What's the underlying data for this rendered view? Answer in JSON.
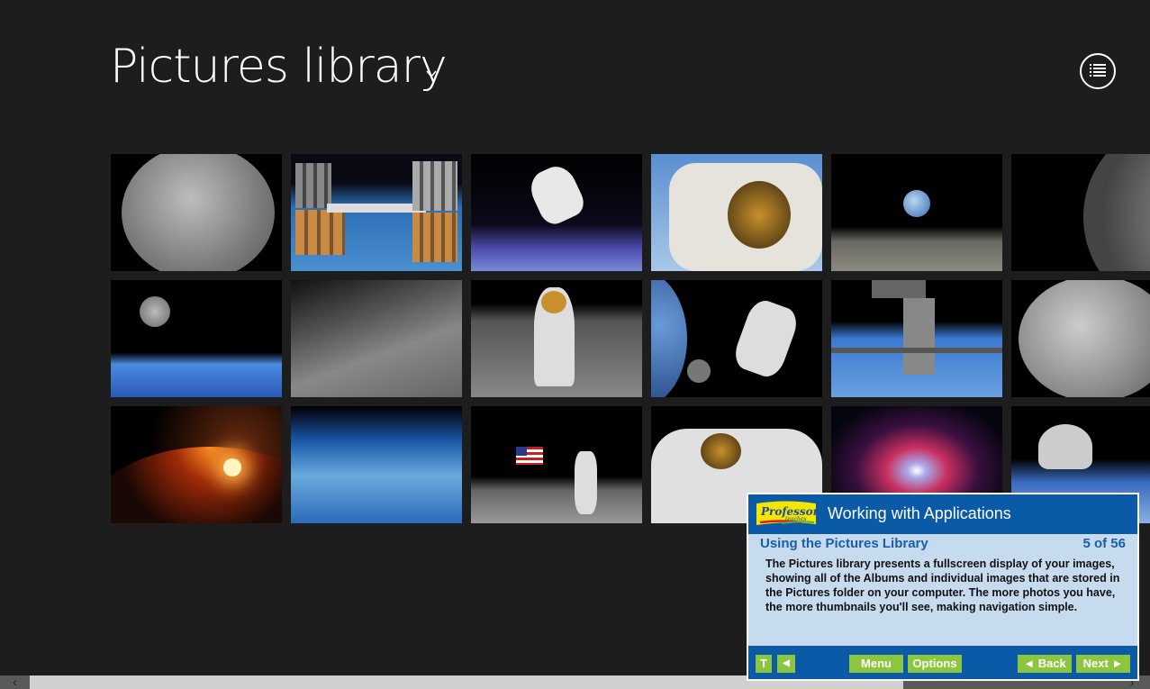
{
  "header": {
    "title": "Pictures library",
    "title_dropdown_icon": "chevron-down-icon",
    "view_button_icon": "list-view-icon"
  },
  "thumbnails": [
    {
      "row": 0,
      "col": 0,
      "subject": "full moon"
    },
    {
      "row": 0,
      "col": 1,
      "subject": "space station over earth"
    },
    {
      "row": 0,
      "col": 2,
      "subject": "astronaut floating above earth"
    },
    {
      "row": 0,
      "col": 3,
      "subject": "astronaut helmet close-up"
    },
    {
      "row": 0,
      "col": 4,
      "subject": "earthrise over lunar surface"
    },
    {
      "row": 0,
      "col": 5,
      "subject": "crescent moon"
    },
    {
      "row": 1,
      "col": 0,
      "subject": "moon above earth horizon"
    },
    {
      "row": 1,
      "col": 1,
      "subject": "lunar craters"
    },
    {
      "row": 1,
      "col": 2,
      "subject": "astronaut on moon"
    },
    {
      "row": 1,
      "col": 3,
      "subject": "astronaut spacewalk with earth and moon"
    },
    {
      "row": 1,
      "col": 4,
      "subject": "space station docked over earth"
    },
    {
      "row": 1,
      "col": 5,
      "subject": "moon surface"
    },
    {
      "row": 2,
      "col": 0,
      "subject": "sunrise over planet"
    },
    {
      "row": 2,
      "col": 1,
      "subject": "earth from orbit"
    },
    {
      "row": 2,
      "col": 2,
      "subject": "astronaut with flag on moon"
    },
    {
      "row": 2,
      "col": 3,
      "subject": "astronaut waving"
    },
    {
      "row": 2,
      "col": 4,
      "subject": "spiral galaxy"
    },
    {
      "row": 2,
      "col": 5,
      "subject": "spacecraft over earth"
    }
  ],
  "scrollbar": {
    "left_arrow": "‹",
    "right_arrow": "›"
  },
  "tutorial": {
    "logo_text": "Professor",
    "logo_subtext": "teaches",
    "course_title": "Working with Applications",
    "lesson_title": "Using the Pictures Library",
    "progress": "5 of 56",
    "body": "The Pictures library presents a fullscreen display of your images, showing all of the Albums and individual images that are stored in the Pictures folder on your computer. The more photos you have, the more thumbnails you'll see, making navigation simple.",
    "buttons": {
      "text": "T",
      "audio": "◀",
      "menu": "Menu",
      "options": "Options",
      "back": "◄ Back",
      "next": "Next ►"
    }
  },
  "colors": {
    "background": "#1d1d1d",
    "tutorial_blue": "#0a5aa8",
    "tutorial_panel": "#c7dbee",
    "tutorial_button": "#8cc63f"
  }
}
